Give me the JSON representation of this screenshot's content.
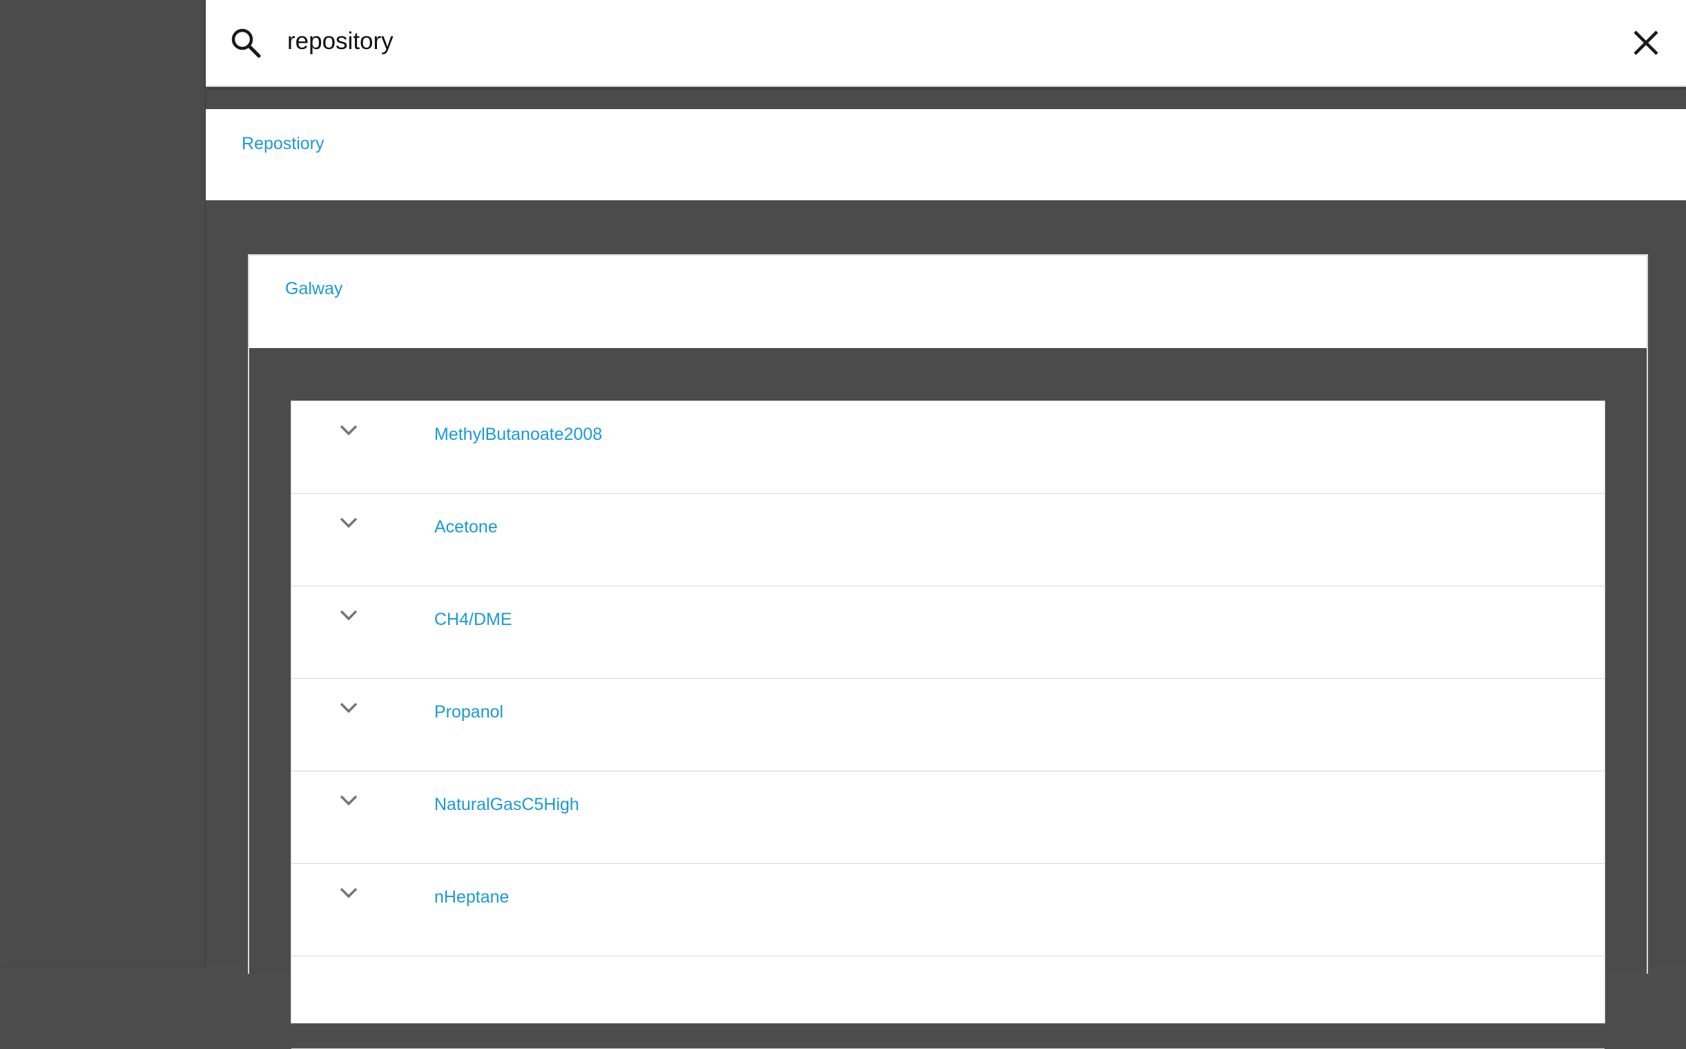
{
  "search": {
    "value": "repository",
    "icon": "search-icon",
    "clear_icon": "close-icon"
  },
  "repository": {
    "label": "Repostiory"
  },
  "group": {
    "label": "Galway"
  },
  "items": [
    {
      "label": "MethylButanoate2008",
      "icon": "chevron-down-icon"
    },
    {
      "label": "Acetone",
      "icon": "chevron-down-icon"
    },
    {
      "label": "CH4/DME",
      "icon": "chevron-down-icon"
    },
    {
      "label": "Propanol",
      "icon": "chevron-down-icon"
    },
    {
      "label": "NaturalGasC5High",
      "icon": "chevron-down-icon"
    },
    {
      "label": "nHeptane",
      "icon": "chevron-down-icon"
    }
  ],
  "colors": {
    "link": "#1a9ad6",
    "background": "#4b4b4b",
    "surface": "#ffffff",
    "icon": "#757575"
  }
}
